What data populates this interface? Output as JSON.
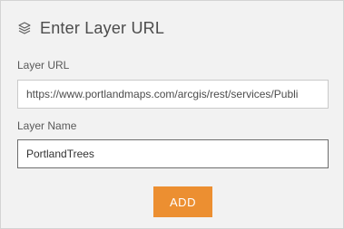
{
  "header": {
    "icon": "layers-icon",
    "title": "Enter Layer URL"
  },
  "form": {
    "url_label": "Layer URL",
    "url_value": "https://www.portlandmaps.com/arcgis/rest/services/Publi",
    "name_label": "Layer Name",
    "name_value": "PortlandTrees"
  },
  "actions": {
    "add_label": "ADD"
  },
  "colors": {
    "panel_background": "#f2f2f2",
    "accent": "#ec8f31",
    "title_text": "#4c4c4c"
  }
}
